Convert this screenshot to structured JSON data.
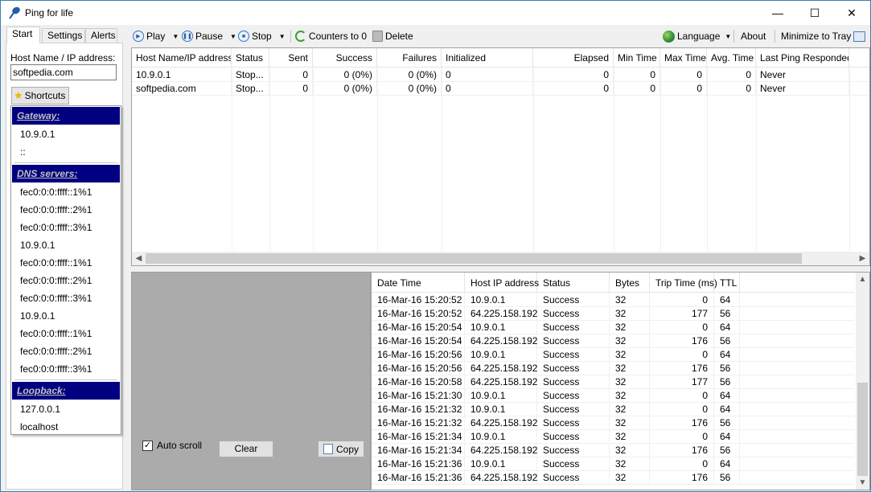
{
  "window": {
    "title": "Ping for life",
    "minimize_glyph": "—",
    "maximize_glyph": "☐",
    "close_glyph": "✕"
  },
  "left_tabs": [
    "Start",
    "Settings",
    "Alerts"
  ],
  "start": {
    "host_label": "Host Name / IP address:",
    "host_value": "softpedia.com",
    "shortcuts_label": "Shortcuts"
  },
  "shortcuts_menu": {
    "gateway_header": "Gateway:",
    "gateway_items": [
      "10.9.0.1",
      "::"
    ],
    "dns_header": "DNS servers:",
    "dns_items": [
      "fec0:0:0:ffff::1%1",
      "fec0:0:0:ffff::2%1",
      "fec0:0:0:ffff::3%1",
      "10.9.0.1",
      "fec0:0:0:ffff::1%1",
      "fec0:0:0:ffff::2%1",
      "fec0:0:0:ffff::3%1",
      "10.9.0.1",
      "fec0:0:0:ffff::1%1",
      "fec0:0:0:ffff::2%1",
      "fec0:0:0:ffff::3%1"
    ],
    "loopback_header": "Loopback:",
    "loopback_items": [
      "127.0.0.1",
      "localhost"
    ]
  },
  "toolbar": {
    "play": "Play",
    "pause": "Pause",
    "stop": "Stop",
    "counters": "Counters to 0",
    "delete": "Delete",
    "language": "Language",
    "about": "About",
    "minimize_tray": "Minimize to Tray"
  },
  "hosts_table": {
    "columns": [
      "Host Name/IP address",
      "Status",
      "Sent",
      "Success",
      "Failures",
      "Initialized",
      "Elapsed",
      "Min Time",
      "Max Time",
      "Avg. Time",
      "Last Ping Responded"
    ],
    "rows": [
      [
        "10.9.0.1",
        "Stop...",
        "0",
        "0 (0%)",
        "0 (0%)",
        "0",
        "0",
        "0",
        "0",
        "0",
        "Never"
      ],
      [
        "softpedia.com",
        "Stop...",
        "0",
        "0 (0%)",
        "0 (0%)",
        "0",
        "0",
        "0",
        "0",
        "0",
        "Never"
      ]
    ]
  },
  "log_options": {
    "auto_scroll": "Auto scroll",
    "auto_scroll_checked": true,
    "clear": "Clear",
    "copy": "Copy"
  },
  "log_table": {
    "columns": [
      "Date Time",
      "Host IP address",
      "Status",
      "Bytes",
      "Trip Time (ms)",
      "TTL"
    ],
    "rows": [
      [
        "16-Mar-16 15:20:52",
        "10.9.0.1",
        "Success",
        "32",
        "0",
        "64"
      ],
      [
        "16-Mar-16 15:20:52",
        "64.225.158.192",
        "Success",
        "32",
        "177",
        "56"
      ],
      [
        "16-Mar-16 15:20:54",
        "10.9.0.1",
        "Success",
        "32",
        "0",
        "64"
      ],
      [
        "16-Mar-16 15:20:54",
        "64.225.158.192",
        "Success",
        "32",
        "176",
        "56"
      ],
      [
        "16-Mar-16 15:20:56",
        "10.9.0.1",
        "Success",
        "32",
        "0",
        "64"
      ],
      [
        "16-Mar-16 15:20:56",
        "64.225.158.192",
        "Success",
        "32",
        "176",
        "56"
      ],
      [
        "16-Mar-16 15:20:58",
        "64.225.158.192",
        "Success",
        "32",
        "177",
        "56"
      ],
      [
        "16-Mar-16 15:21:30",
        "10.9.0.1",
        "Success",
        "32",
        "0",
        "64"
      ],
      [
        "16-Mar-16 15:21:32",
        "10.9.0.1",
        "Success",
        "32",
        "0",
        "64"
      ],
      [
        "16-Mar-16 15:21:32",
        "64.225.158.192",
        "Success",
        "32",
        "176",
        "56"
      ],
      [
        "16-Mar-16 15:21:34",
        "10.9.0.1",
        "Success",
        "32",
        "0",
        "64"
      ],
      [
        "16-Mar-16 15:21:34",
        "64.225.158.192",
        "Success",
        "32",
        "176",
        "56"
      ],
      [
        "16-Mar-16 15:21:36",
        "10.9.0.1",
        "Success",
        "32",
        "0",
        "64"
      ],
      [
        "16-Mar-16 15:21:36",
        "64.225.158.192",
        "Success",
        "32",
        "176",
        "56"
      ]
    ]
  }
}
